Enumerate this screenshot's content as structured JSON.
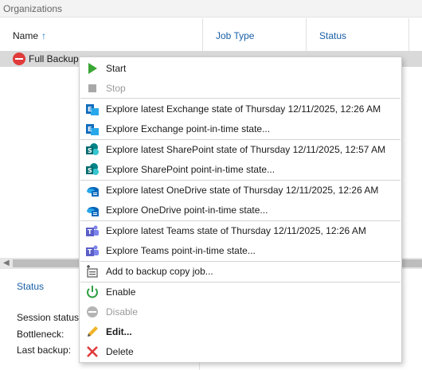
{
  "panel": {
    "title": "Organizations"
  },
  "columns": {
    "name": "Name",
    "sort_arrow": "↑",
    "job_type": "Job Type",
    "status": "Status"
  },
  "row": {
    "name": "Full Backup",
    "status_icon": "error-stop-icon"
  },
  "details": {
    "title": "Status",
    "session_status": "Session status:",
    "bottleneck": "Bottleneck:",
    "last_backup": "Last backup:"
  },
  "menu": {
    "items": [
      {
        "label": "Start",
        "icon": "play-icon"
      },
      {
        "label": "Stop",
        "icon": "stop-icon",
        "disabled": true
      },
      {
        "label": "Explore latest Exchange state of Thursday 12/11/2025, 12:26 AM",
        "icon": "exchange-icon"
      },
      {
        "label": "Explore Exchange point-in-time state...",
        "icon": "exchange-icon"
      },
      {
        "label": "Explore latest SharePoint state of Thursday 12/11/2025, 12:57 AM",
        "icon": "sharepoint-icon"
      },
      {
        "label": "Explore SharePoint point-in-time state...",
        "icon": "sharepoint-icon"
      },
      {
        "label": "Explore latest OneDrive state of Thursday 12/11/2025, 12:26 AM",
        "icon": "onedrive-icon"
      },
      {
        "label": "Explore OneDrive point-in-time state...",
        "icon": "onedrive-icon"
      },
      {
        "label": "Explore latest Teams state of Thursday 12/11/2025, 12:26 AM",
        "icon": "teams-icon"
      },
      {
        "label": "Explore Teams point-in-time state...",
        "icon": "teams-icon"
      },
      {
        "label": "Add to backup copy job...",
        "icon": "backup-copy-icon"
      },
      {
        "label": "Enable",
        "icon": "power-icon"
      },
      {
        "label": "Disable",
        "icon": "disable-icon",
        "disabled": true
      },
      {
        "label": "Edit...",
        "icon": "pencil-icon",
        "bold": true
      },
      {
        "label": "Delete",
        "icon": "delete-x-icon"
      }
    ]
  },
  "colors": {
    "accent_blue": "#1a5fa8",
    "play_green": "#3aa635",
    "power_green": "#2ea043",
    "delete_red": "#e03a3a",
    "exchange_blue": "#0f6cbd",
    "sharepoint_teal": "#038387",
    "teams_purple": "#5b5fc7"
  }
}
